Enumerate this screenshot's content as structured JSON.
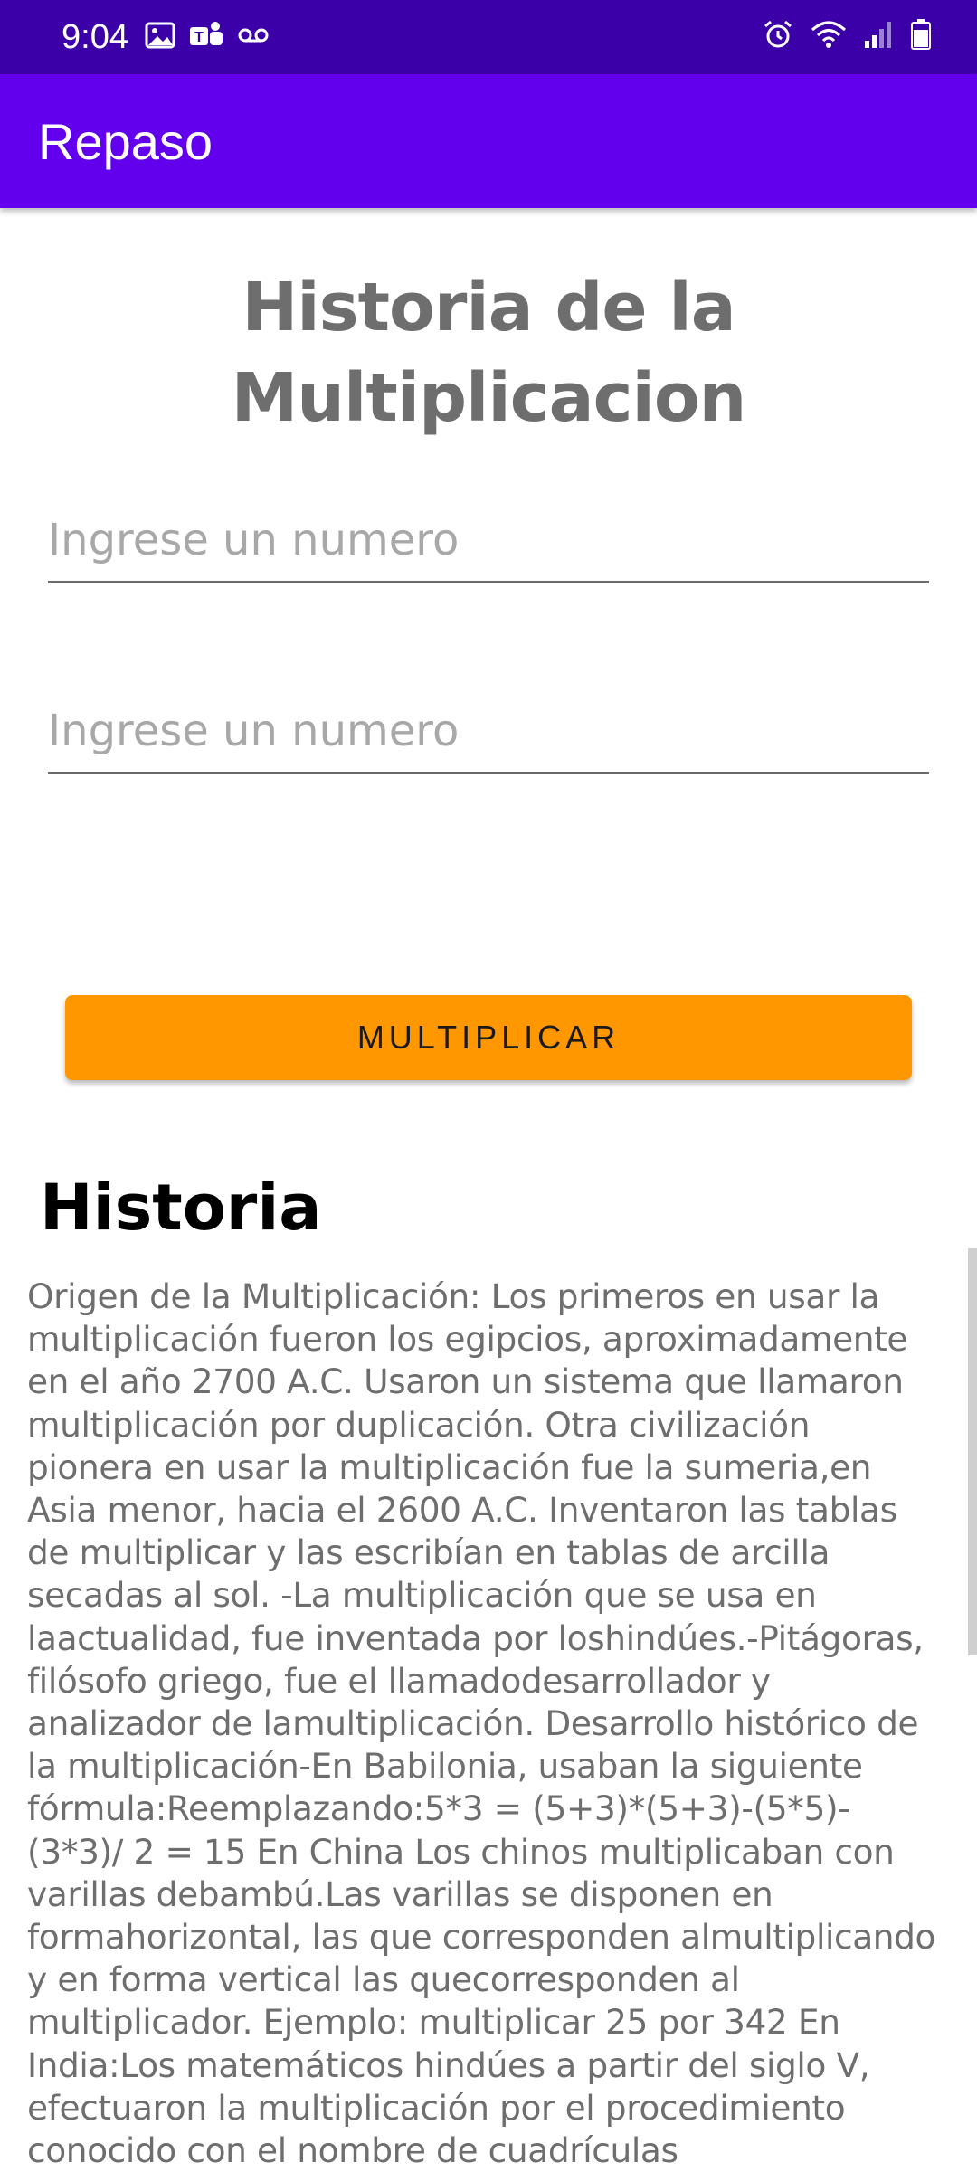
{
  "status_bar": {
    "time": "9:04",
    "left_icons": [
      "image-icon",
      "teams-icon",
      "voicemail-icon"
    ],
    "right_icons": [
      "alarm-icon",
      "wifi-icon",
      "signal-icon",
      "battery-icon"
    ]
  },
  "app_bar": {
    "title": "Repaso"
  },
  "main": {
    "title": "Historia de la Multiplicacion",
    "input1_placeholder": "Ingrese un numero",
    "input2_placeholder": "Ingrese un numero",
    "button_label": "MULTIPLICAR",
    "section_title": "Historia",
    "history_text": "Origen de la Multiplicación: Los primeros en usar la multiplicación fueron los egipcios, aproximadamente en el año 2700 A.C. Usaron un sistema que llamaron multiplicación por duplicación. Otra civilización pionera en usar la multiplicación fue la sumeria,en Asia menor, hacia el 2600 A.C. Inventaron las tablas de multiplicar y las escribían en tablas de arcilla secadas al sol. -La multiplicación que se usa en laactualidad, fue inventada por loshindúes.-Pitágoras, filósofo griego, fue el llamadodesarrollador y analizador de lamultiplicación. Desarrollo histórico de la multiplicación-En Babilonia, usaban la siguiente fórmula:Reemplazando:5*3 = (5+3)*(5+3)-(5*5)-(3*3)/ 2 = 15 En China Los chinos multiplicaban con varillas debambú.Las varillas se disponen en formahorizontal, las que corresponden almultiplicando y en forma vertical las quecorresponden al multiplicador. Ejemplo: multiplicar 25 por 342 En India:Los matemáticos hindúes a partir del siglo V, efectuaron la multiplicación por el procedimiento conocido con el nombre de cuadrículas"
  },
  "colors": {
    "status_bar": "#3c00a8",
    "app_bar": "#6200ee",
    "button": "#ff9800"
  }
}
